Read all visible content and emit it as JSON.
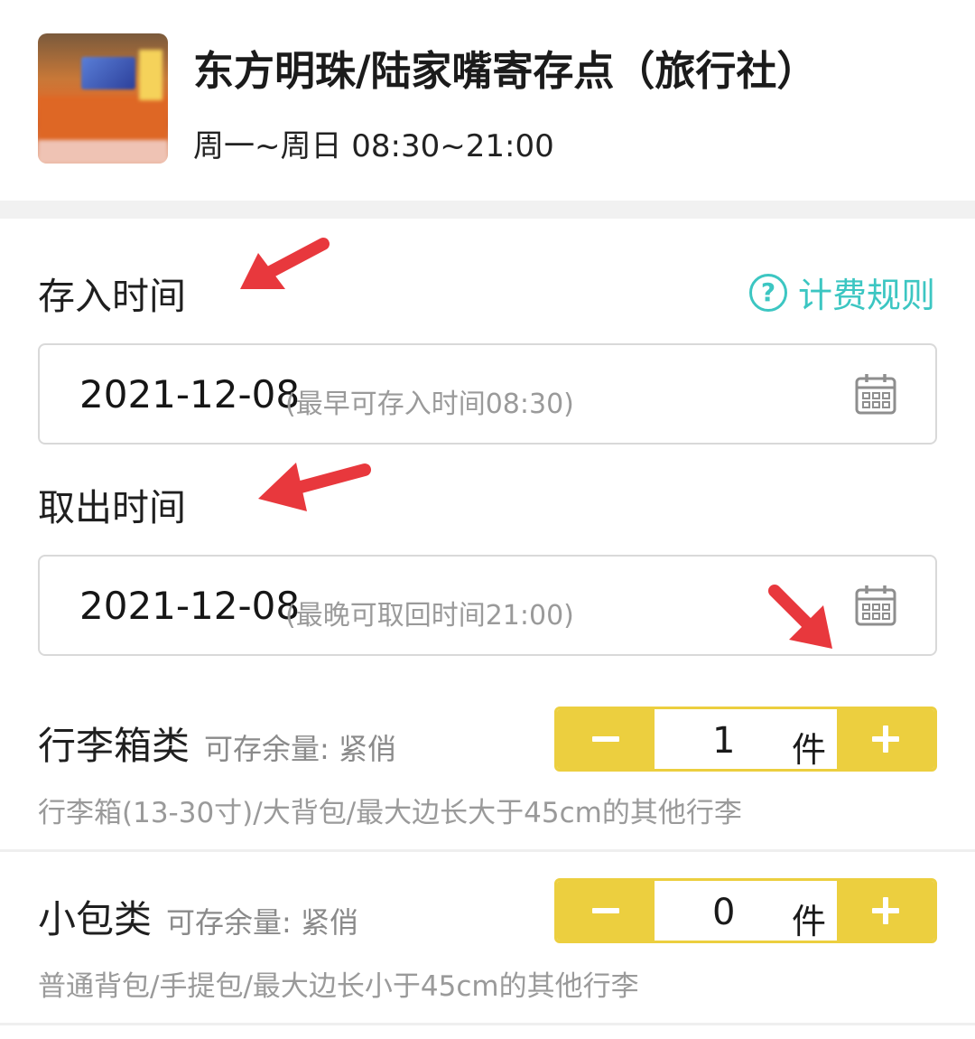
{
  "store": {
    "name": "东方明珠/陆家嘴寄存点（旅行社）",
    "hours": "周一~周日 08:30~21:00"
  },
  "deposit": {
    "label": "存入时间",
    "date": "2021-12-08",
    "hint": "(最早可存入时间08:30)"
  },
  "fee_rules": {
    "label": "计费规则",
    "icon": "question-circle-icon",
    "color": "#3cc6c2"
  },
  "pickup": {
    "label": "取出时间",
    "date": "2021-12-08",
    "hint": "(最晚可取回时间21:00)"
  },
  "items": [
    {
      "name": "行李箱类",
      "stock": "可存余量: 紧俏",
      "quantity": "1",
      "unit": "件",
      "description": "行李箱(13-30寸)/大背包/最大边长大于45cm的其他行李"
    },
    {
      "name": "小包类",
      "stock": "可存余量: 紧俏",
      "quantity": "0",
      "unit": "件",
      "description": "普通背包/手提包/最大边长小于45cm的其他行李"
    }
  ],
  "colors": {
    "stepper": "#eccf3f",
    "annotation_arrow": "#e8383d"
  }
}
